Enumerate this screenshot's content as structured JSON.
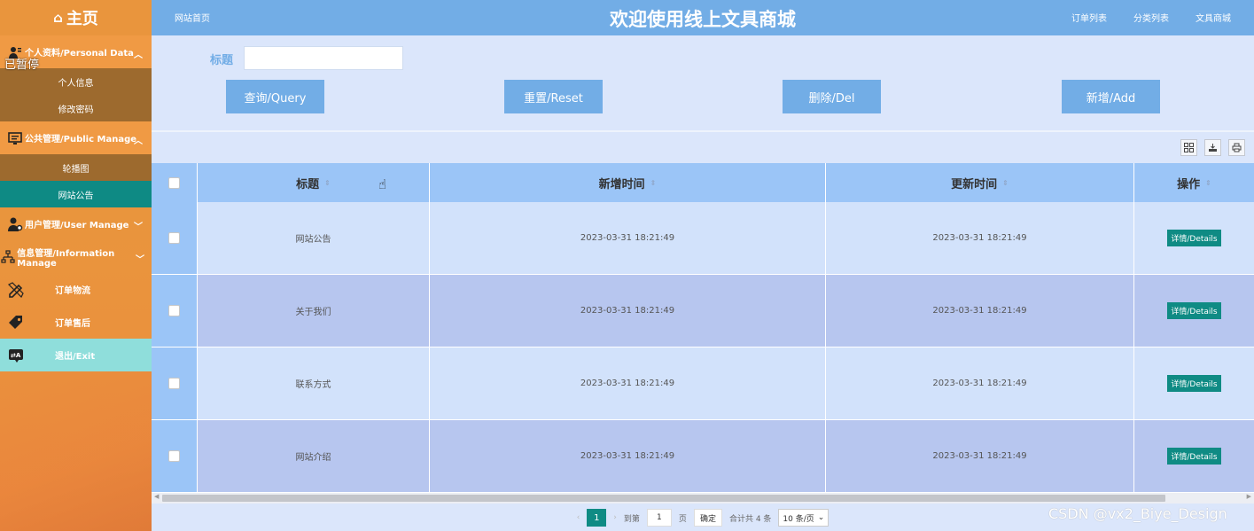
{
  "sidebar": {
    "home": "主页",
    "paused": "已暂停",
    "groups": [
      {
        "label": "个人资料/Personal Data",
        "subs": [
          "个人信息",
          "修改密码"
        ]
      },
      {
        "label": "公共管理/Public Manage",
        "subs": [
          "轮播图",
          "网站公告"
        ]
      },
      {
        "label": "用户管理/User Manage"
      },
      {
        "label": "信息管理/Information Manage"
      }
    ],
    "items": [
      "订单物流",
      "订单售后",
      "退出/Exit"
    ]
  },
  "topbar": {
    "home_link": "网站首页",
    "title": "欢迎使用线上文具商城",
    "nav": [
      "订单列表",
      "分类列表",
      "文具商城"
    ]
  },
  "search": {
    "label": "标题",
    "value": "",
    "buttons": [
      "查询/Query",
      "重置/Reset",
      "删除/Del",
      "新增/Add"
    ]
  },
  "table": {
    "headers": [
      "标题",
      "新增时间",
      "更新时间",
      "操作"
    ],
    "rows": [
      {
        "title": "网站公告",
        "created": "2023-03-31 18:21:49",
        "updated": "2023-03-31 18:21:49",
        "action": "详情/Details"
      },
      {
        "title": "关于我们",
        "created": "2023-03-31 18:21:49",
        "updated": "2023-03-31 18:21:49",
        "action": "详情/Details"
      },
      {
        "title": "联系方式",
        "created": "2023-03-31 18:21:49",
        "updated": "2023-03-31 18:21:49",
        "action": "详情/Details"
      },
      {
        "title": "网站介绍",
        "created": "2023-03-31 18:21:49",
        "updated": "2023-03-31 18:21:49",
        "action": "详情/Details"
      }
    ]
  },
  "pager": {
    "current": "1",
    "goto_label": "到第",
    "goto_value": "1",
    "page_unit": "页",
    "confirm": "确定",
    "total": "合计共 4 条",
    "page_size": "10 条/页"
  },
  "watermark": "CSDN @vx2_Biye_Design"
}
